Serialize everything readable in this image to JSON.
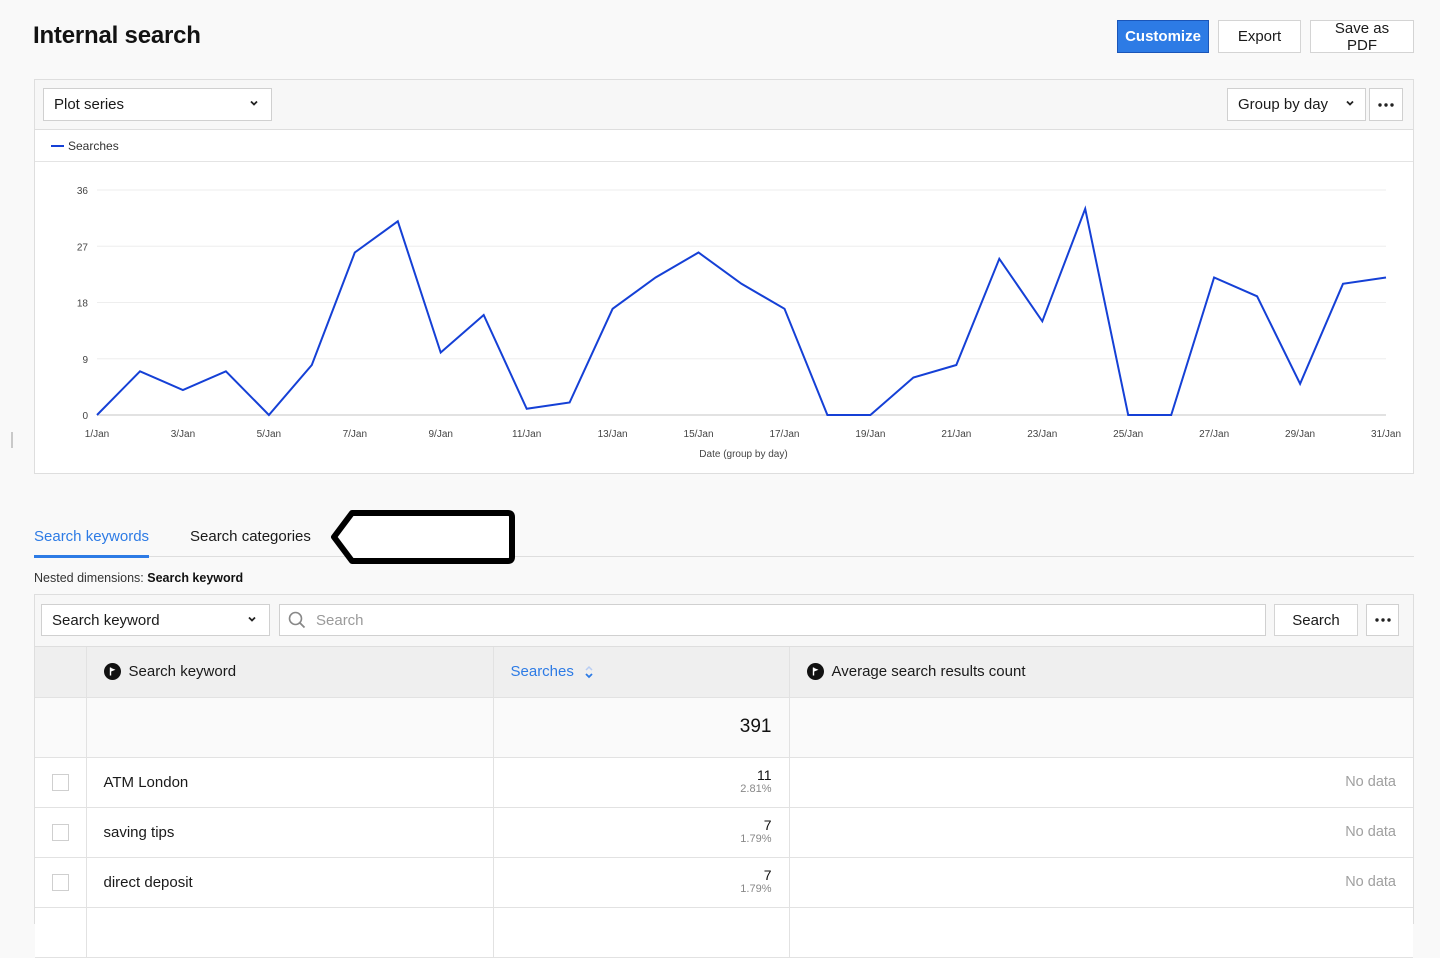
{
  "header": {
    "title": "Internal search",
    "actions": {
      "customize": "Customize",
      "export": "Export",
      "save_pdf": "Save as PDF"
    }
  },
  "colors": {
    "accent": "#2d7be5",
    "series_line": "#1540d6",
    "callout_stroke": "#000000"
  },
  "chart_panel": {
    "plot_series_label": "Plot series",
    "group_by_label": "Group by day",
    "more_icon": "ellipsis-icon"
  },
  "chart_data": {
    "type": "line",
    "title": "",
    "xlabel": "Date (group by day)",
    "ylabel": "",
    "ylim": [
      0,
      36
    ],
    "yticks": [
      0,
      9,
      18,
      27,
      36
    ],
    "grid": true,
    "legend": "top-left",
    "x": [
      "1/Jan",
      "2/Jan",
      "3/Jan",
      "4/Jan",
      "5/Jan",
      "6/Jan",
      "7/Jan",
      "8/Jan",
      "9/Jan",
      "10/Jan",
      "11/Jan",
      "12/Jan",
      "13/Jan",
      "14/Jan",
      "15/Jan",
      "16/Jan",
      "17/Jan",
      "18/Jan",
      "19/Jan",
      "20/Jan",
      "21/Jan",
      "22/Jan",
      "23/Jan",
      "24/Jan",
      "25/Jan",
      "26/Jan",
      "27/Jan",
      "28/Jan",
      "29/Jan",
      "30/Jan",
      "31/Jan"
    ],
    "xtick_labels": [
      "1/Jan",
      "3/Jan",
      "5/Jan",
      "7/Jan",
      "9/Jan",
      "11/Jan",
      "13/Jan",
      "15/Jan",
      "17/Jan",
      "19/Jan",
      "21/Jan",
      "23/Jan",
      "25/Jan",
      "27/Jan",
      "29/Jan",
      "31/Jan"
    ],
    "series": [
      {
        "name": "Searches",
        "values": [
          0,
          7,
          4,
          7,
          0,
          8,
          26,
          31,
          10,
          16,
          1,
          2,
          17,
          22,
          26,
          21,
          17,
          0,
          0,
          6,
          8,
          25,
          15,
          33,
          0,
          0,
          22,
          19,
          5,
          21,
          22
        ]
      }
    ]
  },
  "tabs": [
    {
      "label": "Search keywords",
      "active": true
    },
    {
      "label": "Search categories",
      "active": false
    }
  ],
  "nested": {
    "label": "Nested dimensions:",
    "value": "Search keyword"
  },
  "table_toolbar": {
    "dimension_select": "Search keyword",
    "search_placeholder": "Search",
    "search_value": "",
    "search_button": "Search"
  },
  "table": {
    "columns": [
      {
        "label": "Search keyword",
        "icon": "flag-icon"
      },
      {
        "label": "Searches",
        "sort_icon": "sort-icon",
        "sorted": "desc"
      },
      {
        "label": "Average search results count",
        "icon": "flag-icon"
      }
    ],
    "total": {
      "searches": "391"
    },
    "rows": [
      {
        "keyword": "ATM London",
        "searches": "11",
        "percent": "2.81%",
        "avg_results": "No data"
      },
      {
        "keyword": "saving tips",
        "searches": "7",
        "percent": "1.79%",
        "avg_results": "No data"
      },
      {
        "keyword": "direct deposit",
        "searches": "7",
        "percent": "1.79%",
        "avg_results": "No data"
      }
    ]
  }
}
